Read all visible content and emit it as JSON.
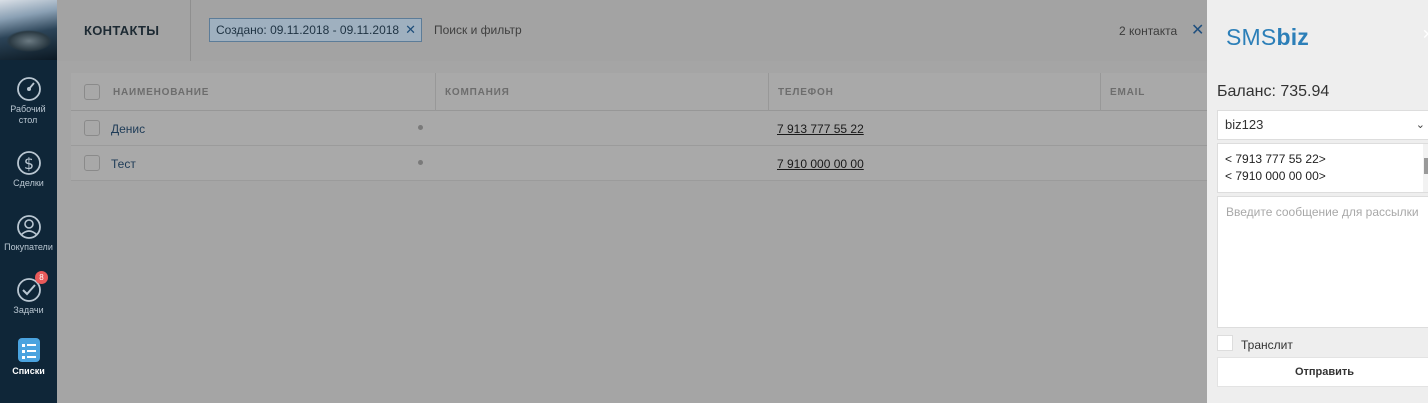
{
  "sidebar": {
    "items": [
      {
        "icon": "dashboard-icon",
        "label": "Рабочий стол"
      },
      {
        "icon": "dollar-icon",
        "label": "Сделки"
      },
      {
        "icon": "customers-icon",
        "label": "Покупатели"
      },
      {
        "icon": "tasks-icon",
        "label": "Задачи",
        "badge": "8"
      },
      {
        "icon": "lists-icon",
        "label": "Списки",
        "active": true
      }
    ]
  },
  "header": {
    "title": "КОНТАКТЫ",
    "filter_chip": "Создано: 09.11.2018 - 09.11.2018",
    "search_placeholder": "Поиск и фильтр",
    "count": "2 контакта"
  },
  "table": {
    "columns": [
      "НАИМЕНОВАНИЕ",
      "КОМПАНИЯ",
      "ТЕЛЕФОН",
      "EMAIL"
    ],
    "rows": [
      {
        "name": "Денис",
        "company": "",
        "phone": "7 913 777 55 22",
        "email": ""
      },
      {
        "name": "Тест",
        "company": "",
        "phone": "7 910 000 00 00",
        "email": ""
      }
    ]
  },
  "sms_panel": {
    "logo_prefix": "SMS",
    "logo_suffix": "biz",
    "balance": "Баланс: 735.94",
    "sender": "biz123",
    "recipients": [
      "< 7913 777 55 22>",
      "< 7910 000 00 00>"
    ],
    "message_placeholder": "Введите сообщение для рассылки",
    "translit_label": "Транслит",
    "send_label": "Отправить"
  },
  "colors": {
    "sidebar_bg": "#0f2638",
    "accent": "#2c7fb8",
    "badge": "#e85a5a",
    "overlay": "#a5a5a5"
  }
}
